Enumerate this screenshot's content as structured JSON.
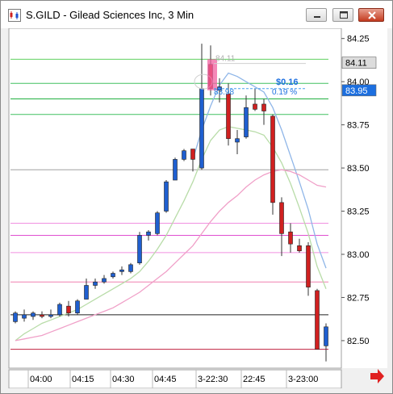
{
  "window": {
    "title": "S.GILD - Gilead Sciences Inc, 3 Min",
    "buttons": [
      "minimize",
      "maximize",
      "close"
    ]
  },
  "chart_data": {
    "type": "candlestick",
    "symbol": "S.GILD",
    "interval": "3 Min",
    "ylim": [
      82.35,
      84.3
    ],
    "y_ticks": [
      "84.25",
      "84.00",
      "83.75",
      "83.50",
      "83.25",
      "83.00",
      "82.75",
      "82.50"
    ],
    "x_ticks": [
      "04:00",
      "04:15",
      "04:30",
      "04:45",
      "3-22:30",
      "22:45",
      "3-23:00"
    ],
    "price_flags": [
      {
        "label": "84.11",
        "value": 84.11,
        "style": "dark"
      },
      {
        "label": "83.95",
        "value": 83.95,
        "style": "blue"
      }
    ],
    "annotations": {
      "top_price": "84.11",
      "change": "$0.16",
      "change_pct": "0.19 %",
      "low_price": "83.98"
    },
    "candles": [
      {
        "o": 82.61,
        "h": 82.67,
        "l": 82.6,
        "c": 82.66
      },
      {
        "o": 82.63,
        "h": 82.68,
        "l": 82.61,
        "c": 82.65
      },
      {
        "o": 82.64,
        "h": 82.67,
        "l": 82.62,
        "c": 82.66
      },
      {
        "o": 82.65,
        "h": 82.67,
        "l": 82.63,
        "c": 82.64
      },
      {
        "o": 82.64,
        "h": 82.68,
        "l": 82.63,
        "c": 82.65
      },
      {
        "o": 82.65,
        "h": 82.72,
        "l": 82.64,
        "c": 82.71
      },
      {
        "o": 82.7,
        "h": 82.73,
        "l": 82.64,
        "c": 82.66
      },
      {
        "o": 82.66,
        "h": 82.74,
        "l": 82.65,
        "c": 82.73
      },
      {
        "o": 82.74,
        "h": 82.86,
        "l": 82.74,
        "c": 82.82
      },
      {
        "o": 82.82,
        "h": 82.86,
        "l": 82.8,
        "c": 82.84
      },
      {
        "o": 82.84,
        "h": 82.88,
        "l": 82.83,
        "c": 82.86
      },
      {
        "o": 82.87,
        "h": 82.9,
        "l": 82.86,
        "c": 82.89
      },
      {
        "o": 82.9,
        "h": 82.93,
        "l": 82.88,
        "c": 82.91
      },
      {
        "o": 82.9,
        "h": 82.95,
        "l": 82.89,
        "c": 82.94
      },
      {
        "o": 82.95,
        "h": 83.13,
        "l": 82.94,
        "c": 83.11
      },
      {
        "o": 83.11,
        "h": 83.14,
        "l": 83.08,
        "c": 83.13
      },
      {
        "o": 83.12,
        "h": 83.25,
        "l": 83.11,
        "c": 83.24
      },
      {
        "o": 83.25,
        "h": 83.43,
        "l": 83.24,
        "c": 83.42
      },
      {
        "o": 83.43,
        "h": 83.56,
        "l": 83.43,
        "c": 83.55
      },
      {
        "o": 83.55,
        "h": 83.61,
        "l": 83.54,
        "c": 83.6
      },
      {
        "o": 83.61,
        "h": 83.59,
        "l": 83.48,
        "c": 83.55
      },
      {
        "o": 83.5,
        "h": 84.22,
        "l": 83.49,
        "c": 83.96
      },
      {
        "o": 84.1,
        "h": 84.21,
        "l": 83.92,
        "c": 83.96
      },
      {
        "o": 83.95,
        "h": 84.02,
        "l": 83.88,
        "c": 83.97
      },
      {
        "o": 83.93,
        "h": 83.99,
        "l": 83.63,
        "c": 83.67
      },
      {
        "o": 83.65,
        "h": 83.72,
        "l": 83.58,
        "c": 83.67
      },
      {
        "o": 83.68,
        "h": 83.92,
        "l": 83.67,
        "c": 83.85
      },
      {
        "o": 83.87,
        "h": 83.96,
        "l": 83.83,
        "c": 83.84
      },
      {
        "o": 83.87,
        "h": 83.9,
        "l": 83.75,
        "c": 83.83
      },
      {
        "o": 83.8,
        "h": 83.81,
        "l": 83.23,
        "c": 83.3
      },
      {
        "o": 83.3,
        "h": 83.33,
        "l": 82.99,
        "c": 83.12
      },
      {
        "o": 83.13,
        "h": 83.18,
        "l": 83.01,
        "c": 83.06
      },
      {
        "o": 83.05,
        "h": 83.09,
        "l": 83.01,
        "c": 83.02
      },
      {
        "o": 83.05,
        "h": 83.07,
        "l": 82.76,
        "c": 82.81
      },
      {
        "o": 82.79,
        "h": 82.8,
        "l": 82.46,
        "c": 82.45
      },
      {
        "o": 82.47,
        "h": 82.6,
        "l": 82.38,
        "c": 82.58
      }
    ],
    "moving_averages": [
      {
        "color": "#8fb6e8",
        "values": [
          null,
          null,
          null,
          null,
          null,
          null,
          null,
          null,
          null,
          null,
          null,
          null,
          null,
          null,
          null,
          null,
          null,
          null,
          null,
          null,
          83.55,
          83.72,
          83.86,
          83.98,
          84.05,
          84.03,
          84.0,
          83.97,
          83.94,
          83.85,
          83.72,
          83.57,
          83.42,
          83.26,
          83.06,
          82.92
        ]
      },
      {
        "color": "#b8dca8",
        "values": [
          82.5,
          82.54,
          82.57,
          82.6,
          82.62,
          82.64,
          82.66,
          82.68,
          82.71,
          82.74,
          82.77,
          82.8,
          82.83,
          82.86,
          82.9,
          82.96,
          83.03,
          83.11,
          83.21,
          83.31,
          83.42,
          83.55,
          83.66,
          83.72,
          83.74,
          83.73,
          83.72,
          83.71,
          83.69,
          83.62,
          83.53,
          83.41,
          83.27,
          83.12,
          82.93,
          82.8
        ]
      },
      {
        "color": "#f0a0c8",
        "values": [
          82.5,
          82.51,
          82.52,
          82.53,
          82.55,
          82.57,
          82.59,
          82.61,
          82.63,
          82.65,
          82.67,
          82.69,
          82.72,
          82.75,
          82.78,
          82.82,
          82.86,
          82.9,
          82.95,
          83.0,
          83.05,
          83.12,
          83.19,
          83.25,
          83.3,
          83.34,
          83.39,
          83.43,
          83.46,
          83.48,
          83.49,
          83.48,
          83.46,
          83.43,
          83.4,
          83.39
        ]
      }
    ],
    "horizontal_lines": [
      {
        "color": "#60d060",
        "values": [
          84.13
        ]
      },
      {
        "color": "#40c060",
        "values": [
          83.99
        ]
      },
      {
        "color": "#20b040",
        "values": [
          83.9
        ]
      },
      {
        "color": "#40c060",
        "values": [
          83.81
        ]
      },
      {
        "color": "#a0a0a0",
        "values": [
          83.49
        ]
      },
      {
        "color": "#f090e0",
        "values": [
          83.18
        ]
      },
      {
        "color": "#e050d0",
        "values": [
          83.11
        ]
      },
      {
        "color": "#f090e0",
        "values": [
          83.01
        ]
      },
      {
        "color": "#f080b0",
        "values": [
          82.84
        ]
      },
      {
        "color": "#202020",
        "values": [
          82.65
        ]
      },
      {
        "color": "#c02040",
        "values": [
          82.45
        ]
      }
    ]
  }
}
